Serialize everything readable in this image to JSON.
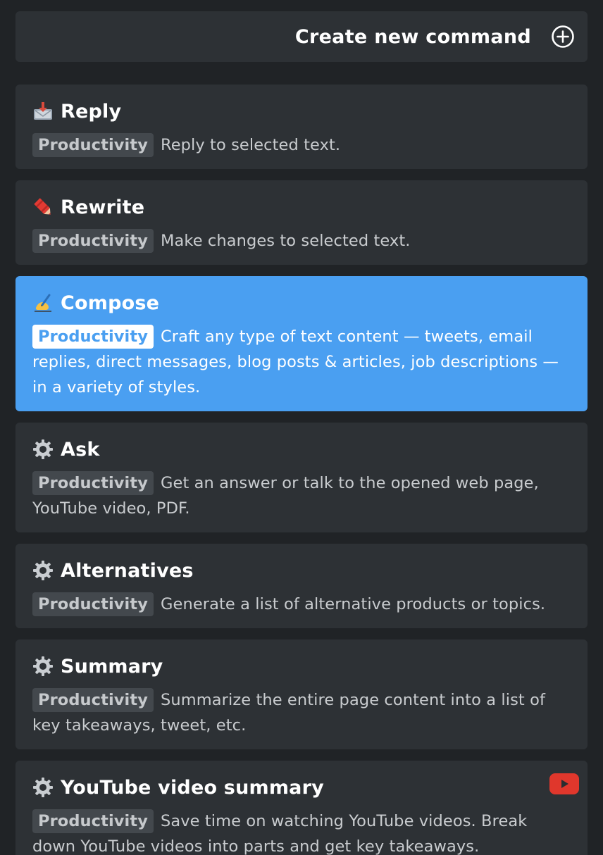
{
  "header": {
    "create_label": "Create new command",
    "create_icon": "plus-circle-icon"
  },
  "commands": [
    {
      "title": "Reply",
      "icon": "inbox-tray-icon",
      "category": "Productivity",
      "description": "Reply to selected text."
    },
    {
      "title": "Rewrite",
      "icon": "crayon-icon",
      "category": "Productivity",
      "description": "Make changes to selected text."
    },
    {
      "title": "Compose",
      "icon": "writing-hand-icon",
      "category": "Productivity",
      "description": "Craft any type of text content — tweets, email replies, direct messages, blog posts & articles, job descriptions — in a variety of styles.",
      "selected": true
    },
    {
      "title": "Ask",
      "icon": "gear-icon",
      "category": "Productivity",
      "description": "Get an answer or talk to the opened web page, YouTube video, PDF."
    },
    {
      "title": "Alternatives",
      "icon": "gear-icon",
      "category": "Productivity",
      "description": "Generate a list of alternative products or topics."
    },
    {
      "title": "Summary",
      "icon": "gear-icon",
      "category": "Productivity",
      "description": "Summarize the entire page content into a list of key takeaways, tweet, etc."
    },
    {
      "title": "YouTube video summary",
      "icon": "gear-icon",
      "category": "Productivity",
      "description": "Save time on watching YouTube videos. Break down YouTube videos into parts and get key takeaways.",
      "badge_icon": "youtube-icon"
    }
  ],
  "colors": {
    "background": "#202326",
    "card": "#2d3135",
    "selected_card": "#4a9ff1",
    "category_badge": "#43484d",
    "youtube_red": "#e0372c"
  }
}
